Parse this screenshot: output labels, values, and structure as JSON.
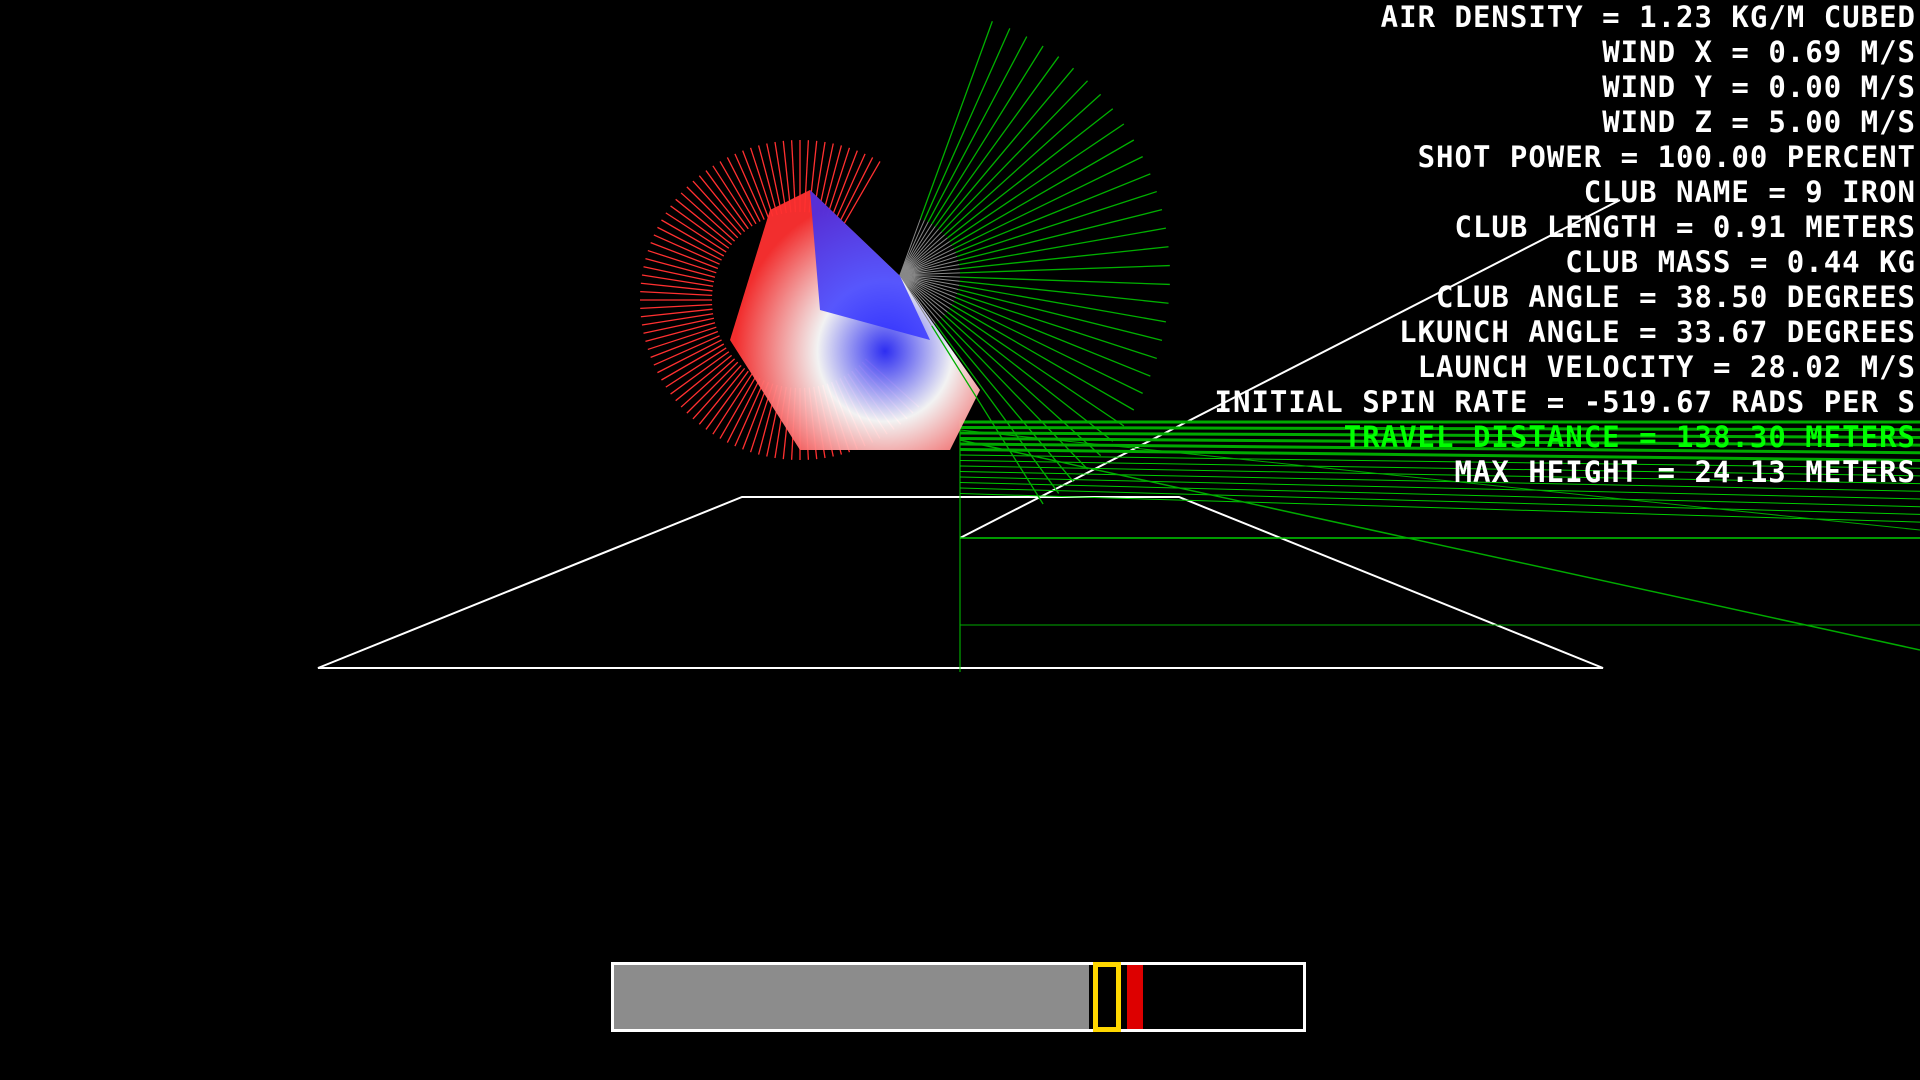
{
  "hud": {
    "air_density": "Air Density = 1.23 kg/m cubed",
    "wind_x": "Wind X = 0.69 m/s",
    "wind_y": "Wind Y = 0.00 m/s",
    "wind_z": "Wind Z = 5.00 m/s",
    "shot_power": "Shot Power = 100.00 percent",
    "club_name": "Club Name = 9 iron",
    "club_length": "Club Length = 0.91 meters",
    "club_mass": "Club Mass = 0.44 kg",
    "club_angle": "Club Angle = 38.50 degrees",
    "launch_angle": "Lkunch Angle = 33.67 degrees",
    "launch_velocity": "Launch Velocity = 28.02 m/s",
    "initial_spin_rate": "Initial Spin Rate = -519.67 rads per s",
    "travel_distance": "Travel Distance = 138.30 meters",
    "max_height": "Max Height = 24.13 meters"
  },
  "power_meter": {
    "fill_fraction": 0.69,
    "sweet_spot_fraction": 0.745,
    "cursor_fraction": 0.715,
    "fill_color": "#8c8c8c",
    "sweet_spot_color": "#dd0000",
    "cursor_color": "#ffd700",
    "border_color": "#ffffff"
  },
  "colors": {
    "background": "#000000",
    "hud_text": "#ffffff",
    "hud_highlight": "#00ff00",
    "sphere_rim": "#ff3030",
    "sphere_inner": "#3030ff",
    "trajectory": "#00cc00",
    "ground": "#ffffff"
  }
}
